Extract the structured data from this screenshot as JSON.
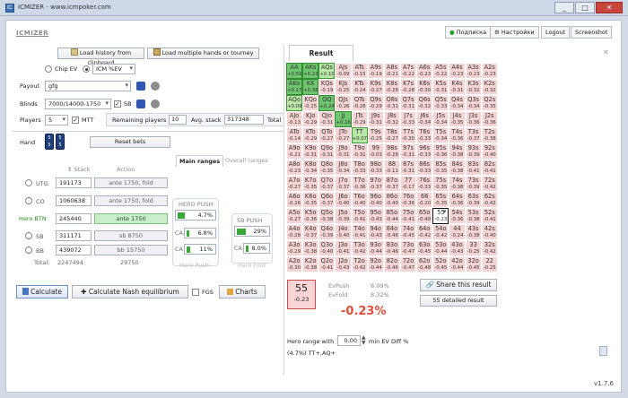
{
  "window": {
    "title": "ICMIZER - www.icmpoker.com",
    "icon_text": "IC",
    "buttons": [
      "_",
      "□",
      "✕"
    ]
  },
  "app": {
    "logo": "ICMIZER",
    "version": "v1.7.6"
  },
  "topnav": {
    "subscribe": "Подписка",
    "settings": "Настройки",
    "logout": "Logout",
    "screenshot": "Screenshot"
  },
  "actions": {
    "load_history": "Load history from clipboard",
    "load_multiple": "Load multiple hands or tourney"
  },
  "mode": {
    "chip_ev": "Chip EV",
    "icm": "ICM %EV"
  },
  "payout": {
    "label": "Payout",
    "value": "gfg"
  },
  "blinds": {
    "label": "Blinds",
    "value": "7000/14000-1750",
    "sb_label": "SB"
  },
  "players": {
    "label": "Players",
    "value": "5",
    "mtt_label": "MTT",
    "remaining_label": "Remaining players",
    "remaining_value": "10",
    "avg_label": "Avg. stack",
    "avg_value": "317348",
    "total_label": "Total"
  },
  "hand": {
    "label": "Hand",
    "reset": "Reset bets",
    "tab_main": "Main ranges",
    "tab_overall": "Overall ranges"
  },
  "table_hdr": {
    "stack": "Stack",
    "action": "Action"
  },
  "seats": [
    {
      "pos": "UTG",
      "stack": "191173",
      "action": "ante 1750, fold"
    },
    {
      "pos": "CO",
      "stack": "1060638",
      "action": "ante 1750, fold"
    },
    {
      "pos": "Hero BTN",
      "stack": "245440",
      "action": "ante 1750"
    },
    {
      "pos": "SB",
      "stack": "311171",
      "action": "sb 8750"
    },
    {
      "pos": "BB",
      "stack": "439072",
      "action": "bb 15750"
    }
  ],
  "totals": {
    "label": "Total:",
    "stack": "2247494",
    "action": "29750"
  },
  "hero_push": {
    "title": "HERO PUSH",
    "pct": "4.7%",
    "ca_sb": "6.8%",
    "ca_bb": "11%",
    "footer": "Hero Push"
  },
  "sb_push": {
    "title": "SB PUSH",
    "pct": "29%",
    "ca": "8.0%",
    "ca_label": "CA",
    "footer": "Hero Fold"
  },
  "bottom": {
    "calculate": "Calculate",
    "nash": "Calculate Nash equilibrium",
    "fgs": "FGS",
    "charts": "Charts"
  },
  "result": {
    "tab": "Result",
    "share": "Share this result",
    "detailed": "55 detailed result",
    "hand": "55",
    "hand_ev": "-0.23",
    "evpush_label": "EvPush",
    "evpush": "8.09%",
    "evfold_label": "EvFold",
    "evfold": "8.32%",
    "diff": "-0.23%",
    "range_label": "Hero range with",
    "range_value": "0.00",
    "range_suffix": "min EV Diff %",
    "range_text": "(4.7%) TT+,AQ+"
  },
  "grid": [
    [
      "AA|+0.59",
      "AKs|+0.23",
      "AQs|+0.10",
      "AJs|-0.09",
      "ATs|-0.15",
      "A9s|-0.19",
      "A8s|-0.21",
      "A7s|-0.22",
      "A6s|-0.23",
      "A5s|-0.22",
      "A4s|-0.23",
      "A3s|-0.23",
      "A2s|-0.23"
    ],
    [
      "AKo|+0.17",
      "KK|+0.36",
      "KQs|-0.19",
      "KJs|-0.25",
      "KTs|-0.24",
      "K9s|-0.27",
      "K8s|-0.28",
      "K7s|-0.28",
      "K6s|-0.30",
      "K5s|-0.31",
      "K4s|-0.31",
      "K3s|-0.32",
      "K2s|-0.32"
    ],
    [
      "AQo|+0.09",
      "KQo|-0.25",
      "QQ|+0.24",
      "QJs|-0.26",
      "QTs|-0.28",
      "Q9s|-0.29",
      "Q8s|-0.31",
      "Q7s|-0.31",
      "Q6s|-0.32",
      "Q5s|-0.33",
      "Q4s|-0.34",
      "Q3s|-0.34",
      "Q2s|-0.35"
    ],
    [
      "AJo|-0.13",
      "KJo|-0.29",
      "QJo|-0.31",
      "JJ|+0.16",
      "JTs|-0.29",
      "J9s|-0.31",
      "J8s|-0.32",
      "J7s|-0.33",
      "J6s|-0.34",
      "J5s|-0.34",
      "J4s|-0.35",
      "J3s|-0.36",
      "J2s|-0.36"
    ],
    [
      "ATo|-0.14",
      "KTo|-0.29",
      "QTo|-0.27",
      "JTo|-0.27",
      "TT|+0.07",
      "T9s|-0.25",
      "T8s|-0.27",
      "T7s|-0.30",
      "T6s|-0.33",
      "T5s|-0.34",
      "T4s|-0.36",
      "T3s|-0.37",
      "T2s|-0.38"
    ],
    [
      "A9o|-0.21",
      "K9o|-0.31",
      "Q9o|-0.31",
      "J9o|-0.31",
      "T9o|-0.31",
      "99|-0.03",
      "98s|-0.28",
      "97s|-0.31",
      "96s|-0.33",
      "95s|-0.36",
      "94s|-0.38",
      "93s|-0.39",
      "92s|-0.40"
    ],
    [
      "A8o|-0.23",
      "K8o|-0.34",
      "Q8o|-0.35",
      "J8o|-0.34",
      "T8o|-0.33",
      "98o|-0.33",
      "88|-0.11",
      "87s|-0.31",
      "86s|-0.33",
      "85s|-0.35",
      "84s|-0.38",
      "83s|-0.41",
      "82s|-0.41"
    ],
    [
      "A7o|-0.27",
      "K7o|-0.35",
      "Q7o|-0.37",
      "J7o|-0.37",
      "T7o|-0.36",
      "97o|-0.37",
      "87o|-0.37",
      "77|-0.17",
      "76s|-0.33",
      "75s|-0.35",
      "74s|-0.38",
      "73s|-0.39",
      "72s|-0.42"
    ],
    [
      "A6o|-0.26",
      "K6o|-0.35",
      "Q6o|-0.37",
      "J6o|-0.40",
      "T6o|-0.40",
      "96o|-0.40",
      "86o|-0.40",
      "76o|-0.36",
      "66|-0.20",
      "65s|-0.35",
      "64s|-0.36",
      "63s|-0.39",
      "62s|-0.42"
    ],
    [
      "A5o|-0.27",
      "K5o|-0.36",
      "Q5o|-0.38",
      "J5o|-0.39",
      "T5o|-0.41",
      "95o|-0.43",
      "85o|-0.44",
      "75o|-0.41",
      "65o|-0.40",
      "55|-0.23",
      "54s|-0.36",
      "53s|-0.38",
      "52s|-0.41"
    ],
    [
      "A4o|-0.28",
      "K4o|-0.37",
      "Q4o|-0.39",
      "J4o|-0.40",
      "T4o|-0.41",
      "94o|-0.43",
      "84o|-0.46",
      "74o|-0.45",
      "64o|-0.42",
      "54o|-0.42",
      "44|-0.24",
      "43s|-0.38",
      "42s|-0.40"
    ],
    [
      "A3o|-0.29",
      "K3o|-0.38",
      "Q3o|-0.40",
      "J3o|-0.41",
      "T3o|-0.42",
      "93o|-0.44",
      "83o|-0.46",
      "73o|-0.47",
      "63o|-0.45",
      "53o|-0.44",
      "43o|-0.43",
      "33|-0.25",
      "32s|-0.42"
    ],
    [
      "A2o|-0.30",
      "K2o|-0.38",
      "Q2o|-0.41",
      "J2o|-0.43",
      "T2o|-0.42",
      "92o|-0.44",
      "82o|-0.46",
      "72o|-0.47",
      "62o|-0.48",
      "52o|-0.45",
      "42o|-0.44",
      "32o|-0.45",
      "22|-0.25"
    ]
  ]
}
